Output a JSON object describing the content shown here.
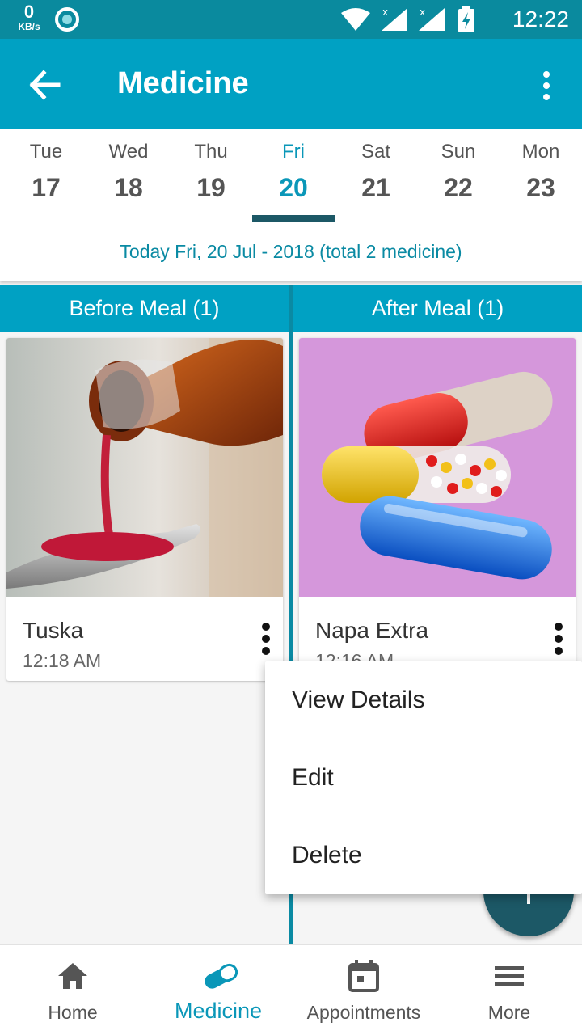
{
  "status_bar": {
    "speed_value": "0",
    "speed_unit": "KB/s",
    "time": "12:22"
  },
  "app_bar": {
    "title": "Medicine",
    "back_icon": "arrow-left-icon",
    "menu_icon": "overflow-menu-icon"
  },
  "date_strip": {
    "days": [
      {
        "name": "Tue",
        "num": "17"
      },
      {
        "name": "Wed",
        "num": "18"
      },
      {
        "name": "Thu",
        "num": "19"
      },
      {
        "name": "Fri",
        "num": "20"
      },
      {
        "name": "Sat",
        "num": "21"
      },
      {
        "name": "Sun",
        "num": "22"
      },
      {
        "name": "Mon",
        "num": "23"
      }
    ],
    "selected_day": "Fri",
    "summary": "Today Fri, 20 Jul - 2018 (total 2 medicine)"
  },
  "columns": {
    "before": {
      "header": "Before Meal (1)",
      "cards": [
        {
          "name": "Tuska",
          "time": "12:18 AM"
        }
      ]
    },
    "after": {
      "header": "After Meal (1)",
      "cards": [
        {
          "name": "Napa Extra",
          "time": "12:16 AM"
        }
      ]
    }
  },
  "popup_menu": {
    "items": [
      "View Details",
      "Edit",
      "Delete"
    ]
  },
  "bottom_nav": {
    "items": [
      {
        "label": "Home",
        "icon": "home-icon"
      },
      {
        "label": "Medicine",
        "icon": "pill-icon"
      },
      {
        "label": "Appointments",
        "icon": "calendar-icon"
      },
      {
        "label": "More",
        "icon": "menu-icon"
      }
    ],
    "active": "Medicine"
  },
  "colors": {
    "status_bar": "#0a8a9e",
    "primary": "#00a1c3",
    "accent": "#0a97b8",
    "dark_accent": "#1c5866"
  }
}
